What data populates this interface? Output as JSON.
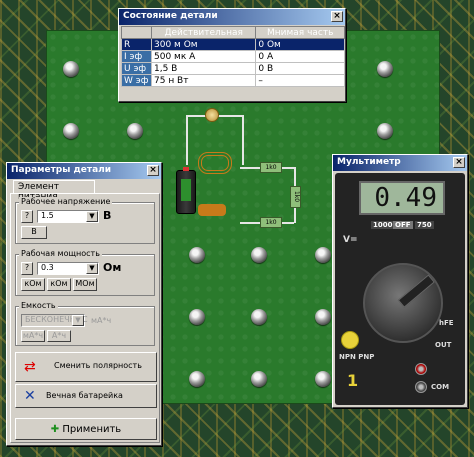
{
  "status_window": {
    "title": "Состояние детали",
    "headers": [
      "",
      "Действительная",
      "Мнимая часть"
    ],
    "rows": [
      {
        "key": "R",
        "real": "300 м Ом",
        "imag": "0 Ом"
      },
      {
        "key": "I эф",
        "real": "500 мк А",
        "imag": "0 А"
      },
      {
        "key": "U эф",
        "real": "1,5 В",
        "imag": "0 В"
      },
      {
        "key": "W эф",
        "real": "75 н Вт",
        "imag": "–"
      }
    ]
  },
  "params_window": {
    "title": "Параметры детали",
    "tab": "Элемент питания",
    "voltage_group": "Рабочее напряжение",
    "voltage_value": "1.5",
    "voltage_unit": "В",
    "voltage_prefix_button": "В",
    "power_group": "Рабочая мощность",
    "power_value": "0.3",
    "power_unit": "Ом",
    "unit_buttons": [
      "кОм",
      "кОм",
      "МОм"
    ],
    "capacity_group": "Емкость",
    "capacity_value": "БЕСКОНЕЧНОС",
    "capacity_unit": "мА*ч",
    "capacity_buttons": [
      "мА*ч",
      "А*ч"
    ],
    "help_label": "?",
    "swap_polarity_button": "Сменить полярность",
    "eternal_battery_button": "Вечная батарейка",
    "apply_button": "Применить"
  },
  "multimeter": {
    "title": "Мультиметр",
    "display": "0.49",
    "label_v": "V=",
    "label_hfe": "hFE",
    "label_com": "COM",
    "label_out": "OUT",
    "label_one": "1",
    "label_npn": "NPN PNP",
    "range_labels": [
      "1000",
      "OFF",
      "750"
    ]
  },
  "circuit": {
    "resistor_labels": [
      "1k0",
      "1k0",
      "1k0"
    ]
  }
}
